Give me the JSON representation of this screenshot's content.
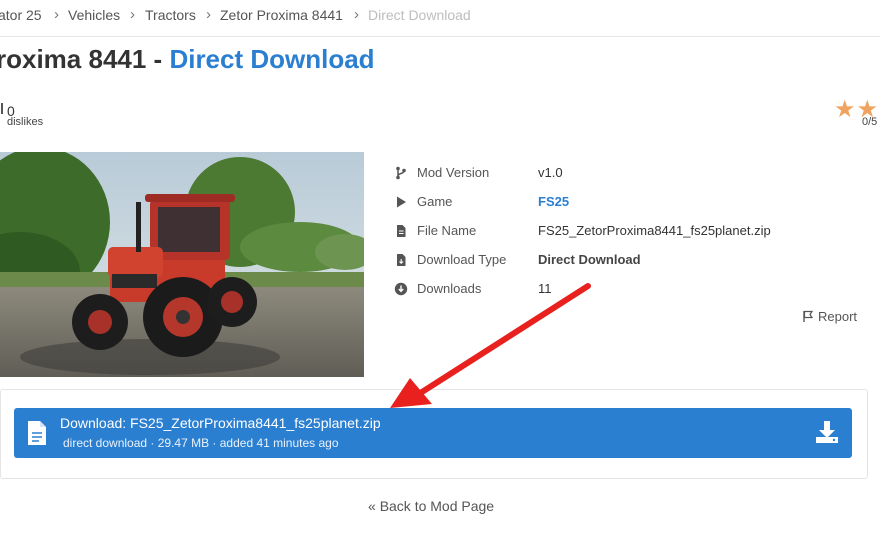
{
  "breadcrumb": {
    "items": [
      "ator 25",
      "Vehicles",
      "Tractors",
      "Zetor Proxima 8441"
    ],
    "current": "Direct Download"
  },
  "title": {
    "main": "roxima 8441 - ",
    "highlight": "Direct Download"
  },
  "likes": {
    "count": "0",
    "label": "dislikes"
  },
  "rating": {
    "text": "0/5",
    "value": 0,
    "max": 5
  },
  "info": {
    "mod_version": {
      "label": "Mod Version",
      "value": "v1.0"
    },
    "game": {
      "label": "Game",
      "value": "FS25"
    },
    "file_name": {
      "label": "File Name",
      "value": "FS25_ZetorProxima8441_fs25planet.zip"
    },
    "download_type": {
      "label": "Download Type",
      "value": "Direct Download"
    },
    "downloads": {
      "label": "Downloads",
      "value": "11"
    }
  },
  "report_label": "Report",
  "download": {
    "title": "Download: FS25_ZetorProxima8441_fs25planet.zip",
    "meta": "direct download · 29.47 MB · added 41 minutes ago"
  },
  "back_label": "Back to Mod Page",
  "icons": [
    "branch-icon",
    "play-icon",
    "file-icon",
    "file-icon",
    "download-circle-icon",
    "flag-icon",
    "file-icon",
    "download-icon",
    "double-chevron-left-icon",
    "star-icon",
    "thumb-icon"
  ],
  "colors": {
    "accent": "#2b7fd1",
    "star": "#f0a35e",
    "arrow": "#e8201e"
  }
}
